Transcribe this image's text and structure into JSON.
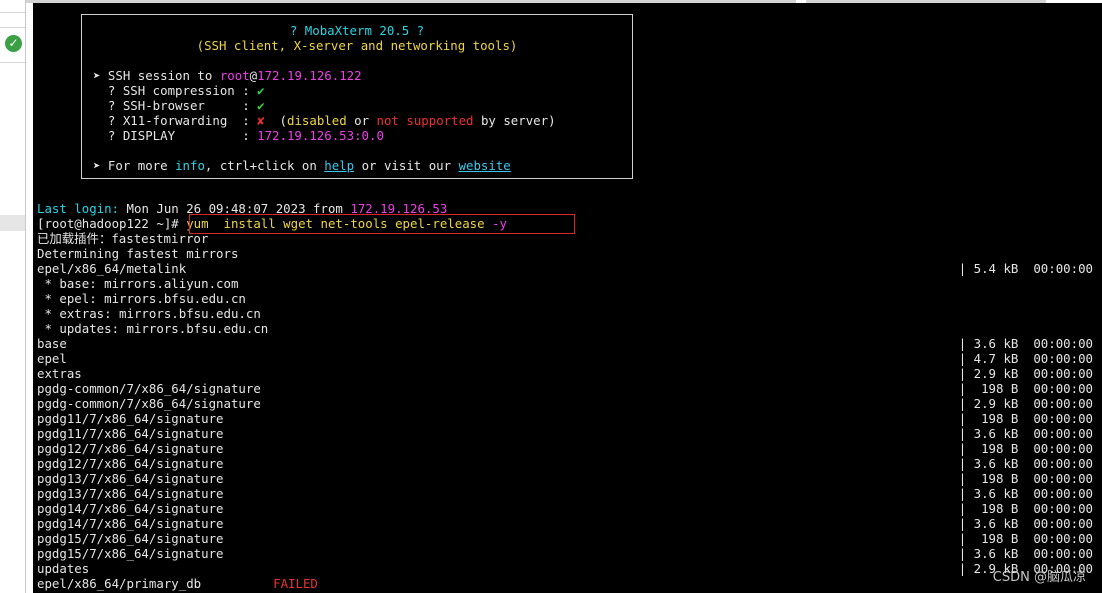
{
  "banner": {
    "title": "? MobaXterm 20.5 ?",
    "subtitle": "(SSH client, X-server and networking tools)",
    "session_prefix": "➤ SSH session to ",
    "session_user": "root",
    "session_at": "@",
    "session_host": "172.19.126.122",
    "rows": [
      {
        "label": "  ? SSH compression : ",
        "value": "✔"
      },
      {
        "label": "  ? SSH-browser     : ",
        "value": "✔"
      }
    ],
    "x11_label": "  ? X11-forwarding  : ",
    "x11_mark": "✘",
    "x11_open": "  (",
    "x11_disabled": "disabled",
    "x11_or": " or ",
    "x11_not_supported": "not supported",
    "x11_tail": " by server)",
    "display_label": "  ? DISPLAY         : ",
    "display_value": "172.19.126.53:0.0",
    "more_prefix": "➤ For more ",
    "more_info": "info",
    "more_mid": ", ctrl+click on ",
    "more_help": "help",
    "more_mid2": " or visit our ",
    "more_website": "website"
  },
  "login": {
    "label": "Last login:",
    "datetime": " Mon Jun 26 09:48:07 2023 ",
    "from": "from ",
    "ip": "172.19.126.53"
  },
  "prompt": {
    "text": "[root@hadoop122 ~]# ",
    "command": "yum  install wget net-tools epel-release ",
    "flag": "-y"
  },
  "output_lines": [
    {
      "left": "已加载插件：fastestmirror",
      "right": ""
    },
    {
      "left": "Determining fastest mirrors",
      "right": ""
    },
    {
      "left": "epel/x86_64/metalink",
      "right": "| 5.4 kB  00:00:00"
    },
    {
      "left": " * base: mirrors.aliyun.com",
      "right": ""
    },
    {
      "left": " * epel: mirrors.bfsu.edu.cn",
      "right": ""
    },
    {
      "left": " * extras: mirrors.bfsu.edu.cn",
      "right": ""
    },
    {
      "left": " * updates: mirrors.bfsu.edu.cn",
      "right": ""
    },
    {
      "left": "base",
      "right": "| 3.6 kB  00:00:00"
    },
    {
      "left": "epel",
      "right": "| 4.7 kB  00:00:00"
    },
    {
      "left": "extras",
      "right": "| 2.9 kB  00:00:00"
    },
    {
      "left": "pgdg-common/7/x86_64/signature",
      "right": "|  198 B  00:00:00"
    },
    {
      "left": "pgdg-common/7/x86_64/signature",
      "right": "| 2.9 kB  00:00:00"
    },
    {
      "left": "pgdg11/7/x86_64/signature",
      "right": "|  198 B  00:00:00"
    },
    {
      "left": "pgdg11/7/x86_64/signature",
      "right": "| 3.6 kB  00:00:00"
    },
    {
      "left": "pgdg12/7/x86_64/signature",
      "right": "|  198 B  00:00:00"
    },
    {
      "left": "pgdg12/7/x86_64/signature",
      "right": "| 3.6 kB  00:00:00"
    },
    {
      "left": "pgdg13/7/x86_64/signature",
      "right": "|  198 B  00:00:00"
    },
    {
      "left": "pgdg13/7/x86_64/signature",
      "right": "| 3.6 kB  00:00:00"
    },
    {
      "left": "pgdg14/7/x86_64/signature",
      "right": "|  198 B  00:00:00"
    },
    {
      "left": "pgdg14/7/x86_64/signature",
      "right": "| 3.6 kB  00:00:00"
    },
    {
      "left": "pgdg15/7/x86_64/signature",
      "right": "|  198 B  00:00:00"
    },
    {
      "left": "pgdg15/7/x86_64/signature",
      "right": "| 3.6 kB  00:00:00"
    },
    {
      "left": "updates",
      "right": "| 2.9 kB  00:00:00"
    }
  ],
  "last_line": {
    "left": "epel/x86_64/primary_db",
    "status": "FAILED"
  },
  "watermark": "CSDN @脑瓜凉",
  "sidebar": {
    "status_icon": "check-circle-icon"
  },
  "colors": {
    "terminal_bg": "#000000",
    "highlight_box": "#d8242c",
    "cyan": "#22d6e6",
    "yellow": "#f0d640",
    "magenta": "#ee3fe8",
    "green": "#3ad13a",
    "red": "#ee3030"
  }
}
